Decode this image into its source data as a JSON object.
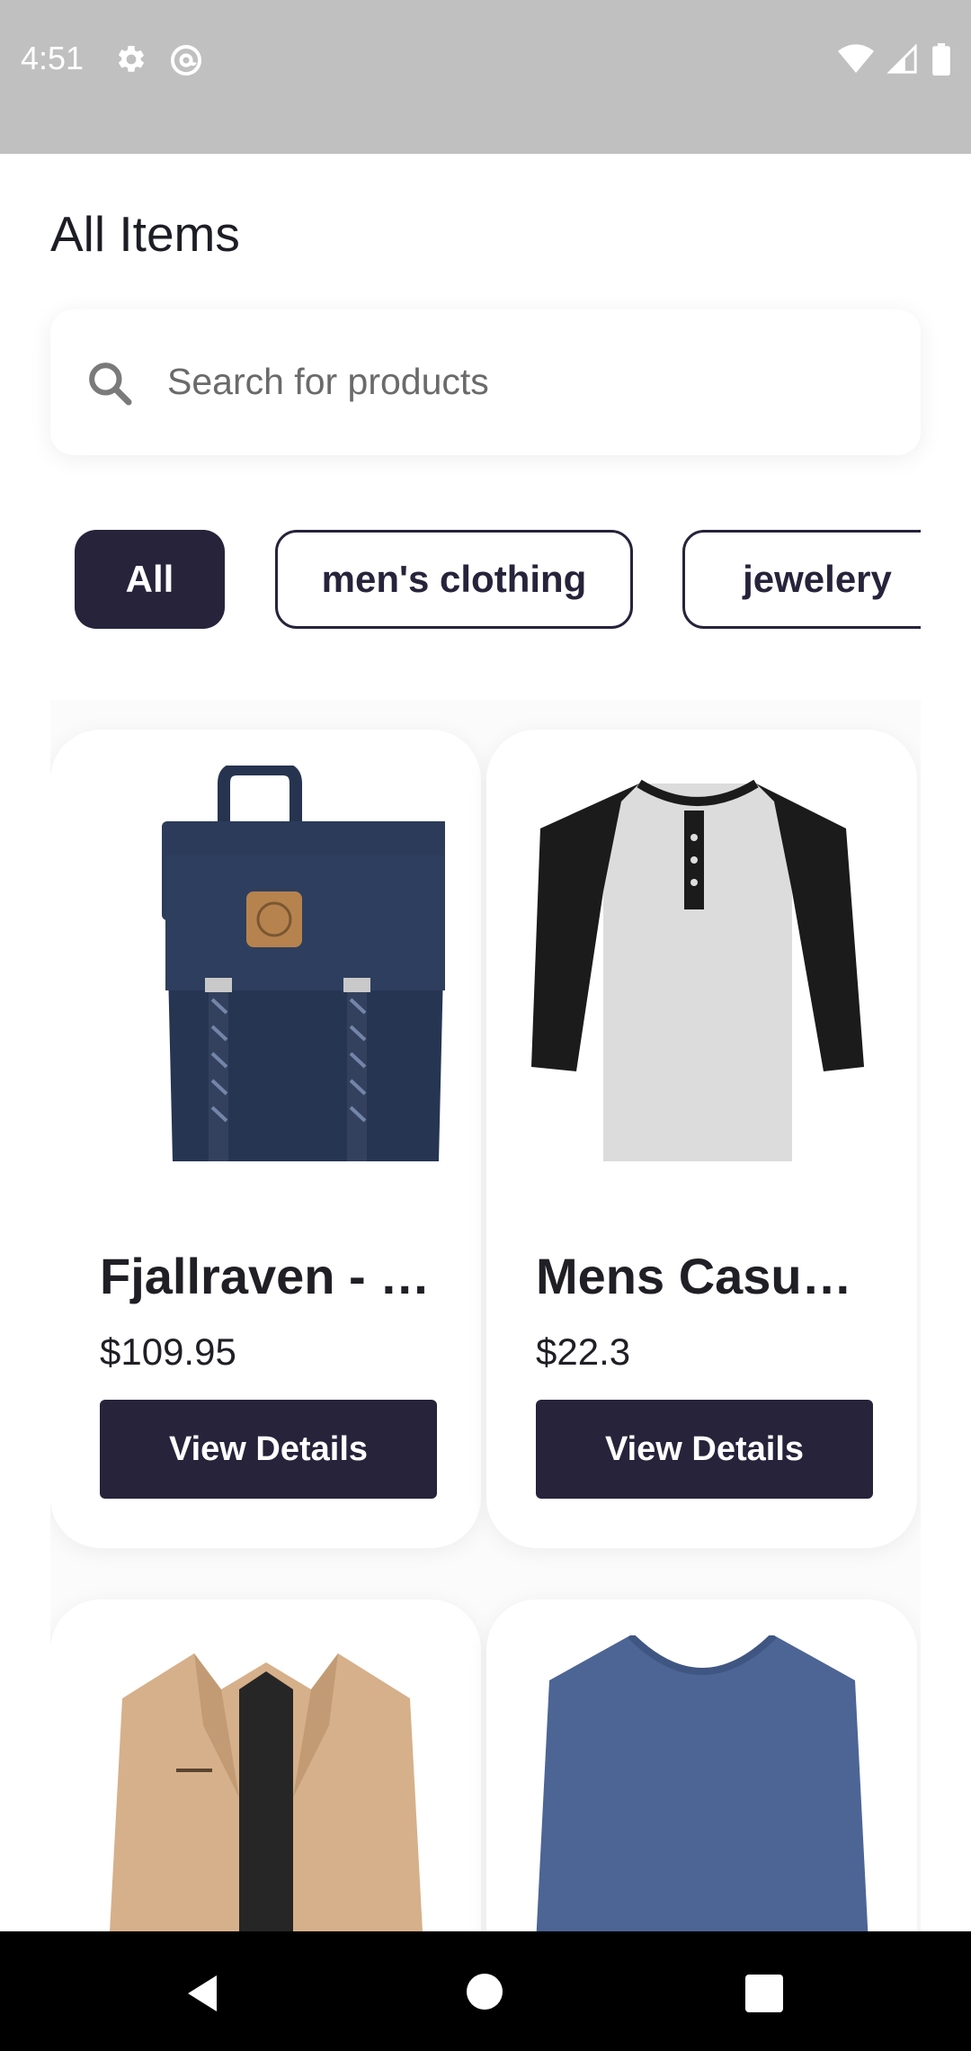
{
  "status_bar": {
    "time": "4:51",
    "left_icons": [
      "gear-icon",
      "at-sign-icon"
    ],
    "right_icons": [
      "wifi-icon",
      "signal-icon",
      "battery-icon"
    ]
  },
  "page": {
    "title": "All Items"
  },
  "search": {
    "placeholder": "Search for products",
    "value": ""
  },
  "categories": [
    {
      "label": "All",
      "selected": true
    },
    {
      "label": "men's clothing",
      "selected": false
    },
    {
      "label": "jewelery",
      "selected": false
    }
  ],
  "products": [
    {
      "title": "Fjallraven - …",
      "price": "$109.95",
      "button": "View Details",
      "image": "backpack-image"
    },
    {
      "title": "Mens Casual …",
      "price": "$22.3",
      "button": "View Details",
      "image": "raglan-shirt-image"
    },
    {
      "image": "jacket-image"
    },
    {
      "image": "blue-long-sleeve-shirt-image"
    }
  ],
  "colors": {
    "primary": "#26233b",
    "status_bar": "#c0c0c0",
    "nav_bar": "#000000"
  },
  "nav": {
    "icons": [
      "back-icon",
      "home-icon",
      "recent-apps-icon"
    ]
  }
}
